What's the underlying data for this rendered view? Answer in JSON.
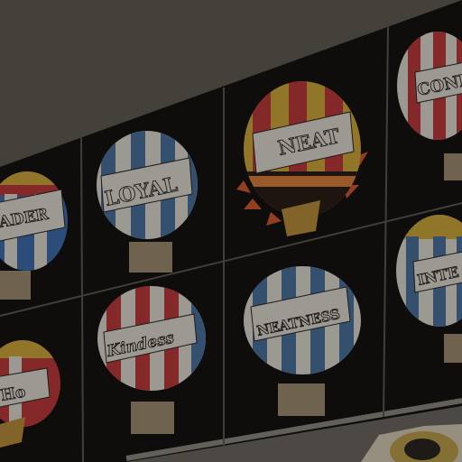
{
  "scene": {
    "description_type": "photo",
    "colors": {
      "wall": "#5f5a53",
      "board": "#141210",
      "board_lines": "#5a5650",
      "red": "#b8383a",
      "blue": "#4a6f9a",
      "yellow": "#c9a23a",
      "white": "#d9d4cc",
      "basket": "#9a8a70"
    }
  },
  "balloons": [
    {
      "word": "ADER",
      "palette": [
        "#3d6aa8",
        "#d9d4cc",
        "#c9a23a",
        "#b8383a"
      ]
    },
    {
      "word": "LOYAL",
      "palette": [
        "#4a6f9a",
        "#d9d4cc"
      ]
    },
    {
      "word": "NEAT",
      "palette": [
        "#b8383a",
        "#c9a23a",
        "#d47c3a"
      ]
    },
    {
      "word": "CONF",
      "palette": [
        "#b8383a",
        "#d9d4cc"
      ]
    },
    {
      "word": "Kindess",
      "palette": [
        "#b8383a",
        "#d9d4cc",
        "#4a6f9a"
      ]
    },
    {
      "word": "NEATNESS",
      "palette": [
        "#4a6f9a",
        "#d9d4cc"
      ]
    },
    {
      "word": "Ho",
      "palette": [
        "#b8383a",
        "#c9a23a"
      ]
    },
    {
      "word": "INTE",
      "palette": [
        "#4a6f9a",
        "#d9d4cc",
        "#c9a23a"
      ]
    }
  ]
}
